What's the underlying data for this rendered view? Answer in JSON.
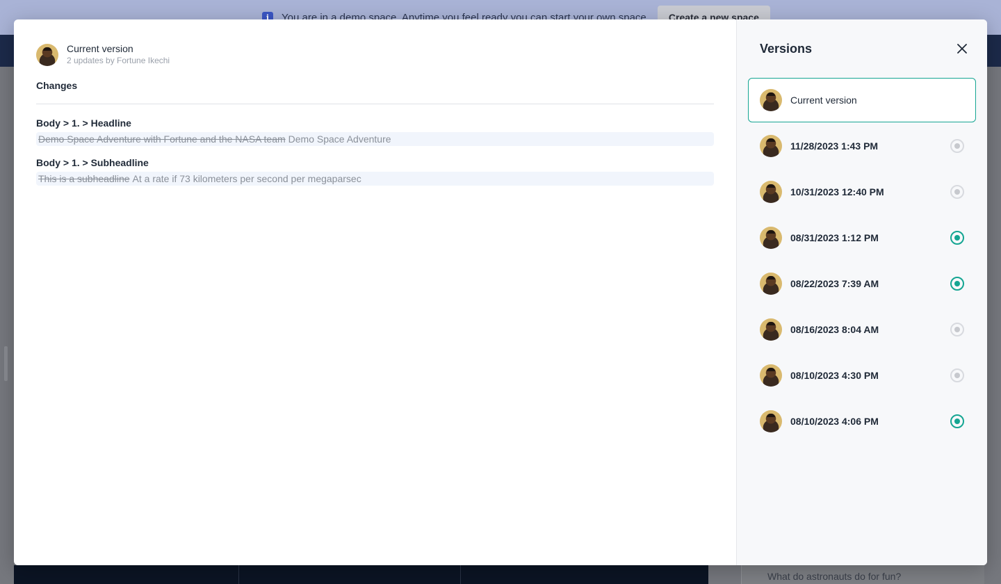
{
  "background": {
    "banner_text": "You are in a demo space. Anytime you feel ready you can start your own space.",
    "banner_button": "Create a new space",
    "bottom_card_text": "What do astronauts do for fun?"
  },
  "changes": {
    "header_title": "Current version",
    "header_subtitle": "2 updates by Fortune Ikechi",
    "heading": "Changes",
    "items": [
      {
        "path": "Body > 1. > Headline",
        "old": "Demo Space Adventure with Fortune and the NASA team",
        "new": "Demo Space Adventure"
      },
      {
        "path": "Body > 1. > Subheadline",
        "old": "This is a subheadline",
        "new": "At a rate if 73 kilometers per second per megaparsec"
      }
    ]
  },
  "versions": {
    "title": "Versions",
    "current_label": "Current version",
    "items": [
      {
        "label": "11/28/2023 1:43 PM",
        "published": false
      },
      {
        "label": "10/31/2023 12:40 PM",
        "published": false
      },
      {
        "label": "08/31/2023 1:12 PM",
        "published": true
      },
      {
        "label": "08/22/2023 7:39 AM",
        "published": true
      },
      {
        "label": "08/16/2023 8:04 AM",
        "published": false
      },
      {
        "label": "08/10/2023 4:30 PM",
        "published": false
      },
      {
        "label": "08/10/2023 4:06 PM",
        "published": true
      }
    ]
  },
  "colors": {
    "accent": "#14a592",
    "overlay": "#6f7279",
    "banner": "#a9b3d6"
  }
}
